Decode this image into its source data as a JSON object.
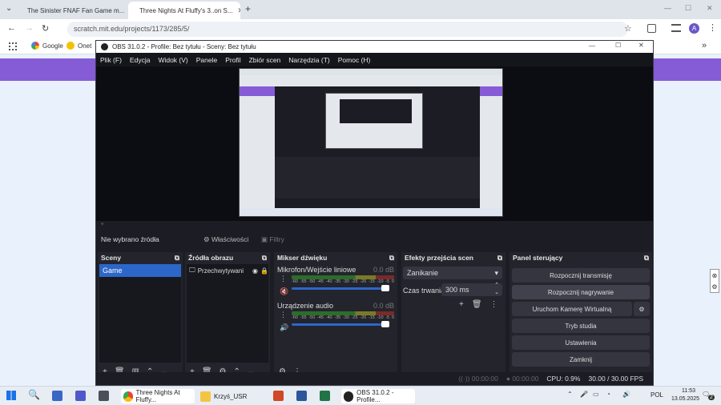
{
  "browser": {
    "tabs": [
      {
        "title": "The Sinister FNAF Fan Game m..."
      },
      {
        "title": "Three Nights At Fluffy's 3..on S..."
      }
    ],
    "new_tab": "+",
    "url": "scratch.mit.edu/projects/1173/285/5/",
    "profile_initial": "A",
    "bookmarks": [
      {
        "label": "Google"
      },
      {
        "label": "Onet"
      }
    ]
  },
  "obs": {
    "title": "OBS 31.0.2 - Profile: Bez tytułu - Sceny: Bez tytułu",
    "menu": [
      "Plik (F)",
      "Edycja",
      "Widok (V)",
      "Panele",
      "Profil",
      "Zbiór scen",
      "Narzędzia (T)",
      "Pomoc (H)"
    ],
    "no_source": "Nie wybrano źródła",
    "properties": "Właściwości",
    "filters": "Filtry",
    "scenes": {
      "title": "Sceny",
      "items": [
        "Game"
      ]
    },
    "sources": {
      "title": "Źródła obrazu",
      "items": [
        "Przechwytywani"
      ]
    },
    "mixer": {
      "title": "Mikser dźwięku",
      "scale": [
        "-60",
        "-55",
        "-50",
        "-45",
        "-40",
        "-35",
        "-30",
        "-25",
        "-20",
        "-15",
        "-10",
        "-5",
        "0"
      ],
      "channels": [
        {
          "name": "Mikrofon/Wejście liniowe",
          "db": "0.0 dB"
        },
        {
          "name": "Urządzenie audio",
          "db": "0.0 dB"
        }
      ]
    },
    "transitions": {
      "title": "Efekty przejścia scen",
      "type": "Zanikanie",
      "duration_label": "Czas trwania",
      "duration": "300 ms"
    },
    "controls": {
      "title": "Panel sterujący",
      "buttons": [
        "Rozpocznij transmisję",
        "Rozpocznij nagrywanie",
        "Uruchom Kamerę Wirtualną",
        "Tryb studia",
        "Ustawienia",
        "Zamknij"
      ]
    },
    "status": {
      "stream_time": "00:00:00",
      "rec_time": "00:00:00",
      "cpu": "CPU: 0.9%",
      "fps": "30.00 / 30.00 FPS"
    }
  },
  "taskbar": {
    "items": [
      "Three Nights At Fluffy...",
      "Krzyś_USR",
      "OBS 31.0.2 - Profile..."
    ],
    "lang": "POL",
    "time": "11:53",
    "date": "13.05.2025",
    "badge": "2"
  },
  "colors": {
    "obs_bg": "#1c1d24",
    "accent": "#2c66c9",
    "taskbar": "#e8edf4"
  }
}
